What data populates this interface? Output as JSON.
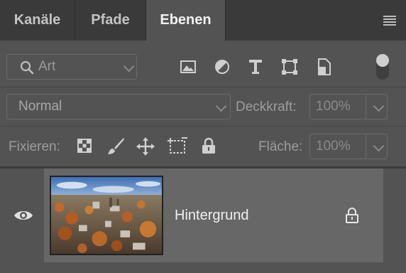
{
  "tabs": [
    {
      "label": "Kanäle",
      "active": false
    },
    {
      "label": "Pfade",
      "active": false
    },
    {
      "label": "Ebenen",
      "active": true
    }
  ],
  "filter": {
    "placeholder": "Art",
    "icons": [
      "image-filter-icon",
      "adjustment-filter-icon",
      "type-filter-icon",
      "shape-filter-icon",
      "smart-object-filter-icon",
      "filter-toggle-icon"
    ]
  },
  "blend_mode": {
    "value": "Normal"
  },
  "opacity": {
    "label": "Deckkraft:",
    "value": "100%"
  },
  "lock": {
    "label": "Fixieren:",
    "icons": [
      "lock-transparent-pixels-icon",
      "lock-image-pixels-icon",
      "lock-position-icon",
      "lock-artboard-icon",
      "lock-all-icon"
    ]
  },
  "fill": {
    "label": "Fläche:",
    "value": "100%"
  },
  "layers": [
    {
      "name": "Hintergrund",
      "visible": true,
      "locked": true
    }
  ],
  "colors": {
    "panel": "#535353",
    "tabbar": "#3a3a3a",
    "selected_row": "#676767"
  }
}
